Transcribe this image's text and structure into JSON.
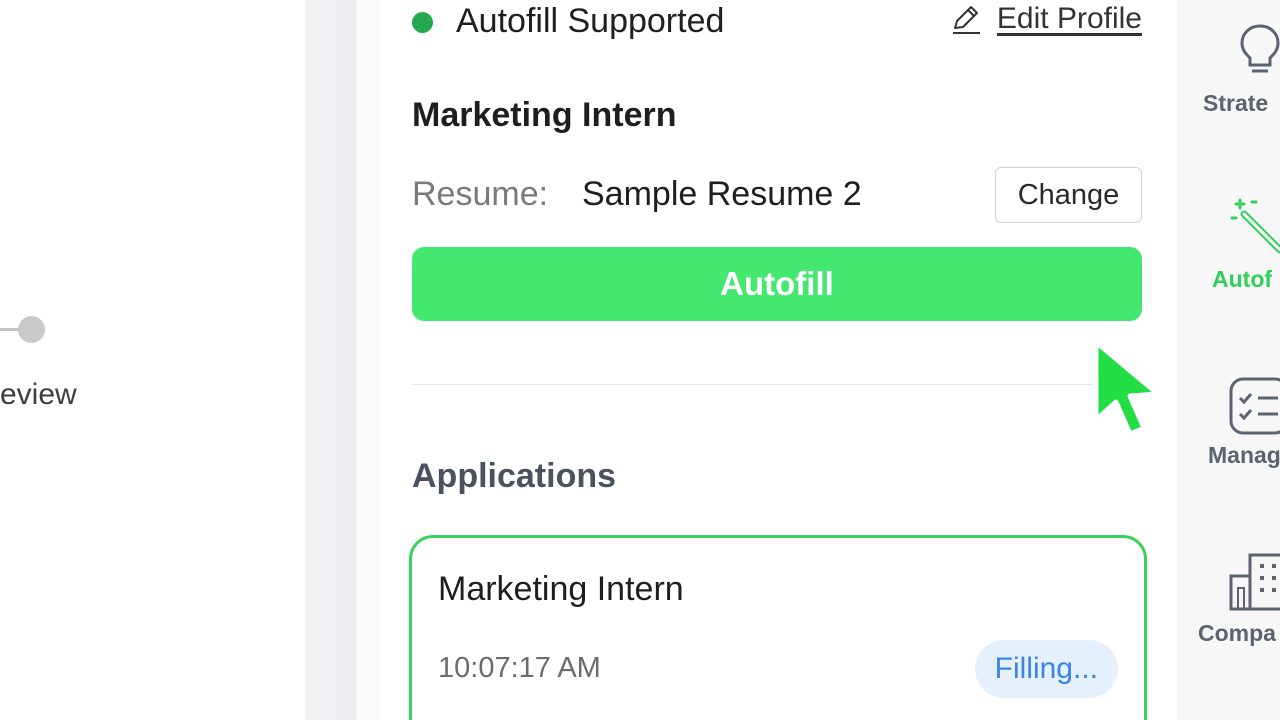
{
  "background_page": {
    "step_label": "eview"
  },
  "status": {
    "text": "Autofill Supported",
    "dot_color": "#22a952",
    "edit_profile_label": "Edit Profile"
  },
  "job": {
    "title": "Marketing Intern",
    "resume_label": "Resume:",
    "resume_value": "Sample Resume 2",
    "change_label": "Change"
  },
  "autofill_button": {
    "label": "Autofill",
    "color": "#44e870"
  },
  "applications": {
    "section_title": "Applications",
    "items": [
      {
        "title": "Marketing Intern",
        "time": "10:07:17 AM",
        "status": "Filling..."
      }
    ]
  },
  "rail": {
    "items": [
      {
        "label": "Strate",
        "icon": "lightbulb-icon"
      },
      {
        "label": "Autof",
        "icon": "magic-wand-icon",
        "active": true
      },
      {
        "label": "Manag",
        "icon": "checklist-icon"
      },
      {
        "label": "Compa",
        "icon": "building-icon"
      }
    ],
    "accent": "#2fcf5a"
  },
  "cursor": {
    "icon": "mouse-pointer-icon",
    "color": "#22dd44"
  }
}
